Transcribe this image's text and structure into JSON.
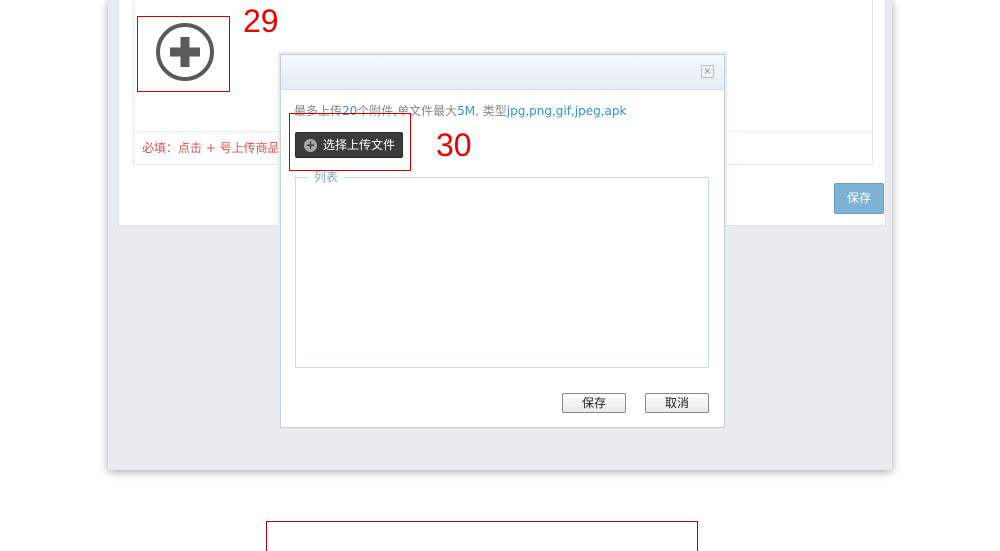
{
  "page": {
    "required_note": "必填：点击 + 号上传商品",
    "save_label": "保存"
  },
  "callouts": {
    "add_number": "29",
    "choose_number": "30"
  },
  "dialog": {
    "close_glyph": "×",
    "info": {
      "part1": "最多上传",
      "max_count": "20",
      "part2": "个附件,单文件最大",
      "max_size": "5M",
      "part3": ", 类型",
      "types": "jpg,png,gif,jpeg,apk"
    },
    "choose_label": "选择上传文件",
    "choose_icon_glyph": "+",
    "list_legend": "列表",
    "save_label": "保存",
    "cancel_label": "取消"
  },
  "colors": {
    "accent_blue": "#2a95d8",
    "callout_red": "#ee0000",
    "required_red": "#d9534f",
    "page_save_button": "#7fb3d5"
  },
  "icons": {
    "add": "circle-plus-icon",
    "close": "close-icon",
    "upload_plus": "plus-circle-icon"
  }
}
